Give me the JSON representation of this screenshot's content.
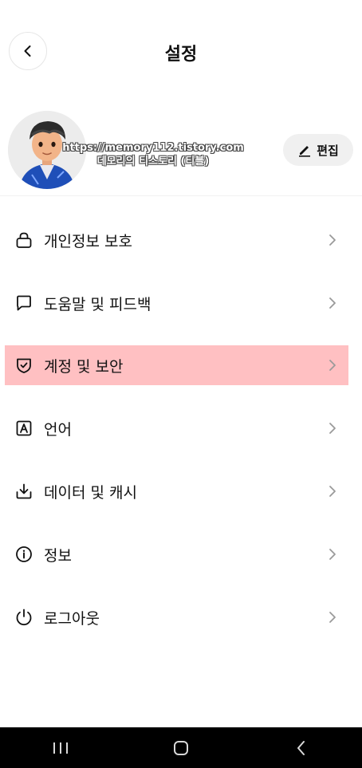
{
  "header": {
    "title": "설정"
  },
  "profile": {
    "watermark_line1": "https://memory112.tistory.com",
    "watermark_line2": "데모리의 티스토리 (티블)",
    "edit_label": "편집"
  },
  "menu": {
    "items": [
      {
        "label": "개인정보 보호",
        "icon": "lock-icon"
      },
      {
        "label": "도움말 및 피드백",
        "icon": "chat-bubble-icon"
      },
      {
        "label": "계정 및 보안",
        "icon": "shield-check-icon",
        "highlighted": true
      },
      {
        "label": "언어",
        "icon": "language-a-icon"
      },
      {
        "label": "데이터 및 캐시",
        "icon": "download-icon"
      },
      {
        "label": "정보",
        "icon": "info-icon"
      },
      {
        "label": "로그아웃",
        "icon": "power-icon"
      }
    ]
  },
  "colors": {
    "highlight": "#ffc0c2",
    "navbar": "#000000",
    "chevron": "#9a9a9a"
  }
}
